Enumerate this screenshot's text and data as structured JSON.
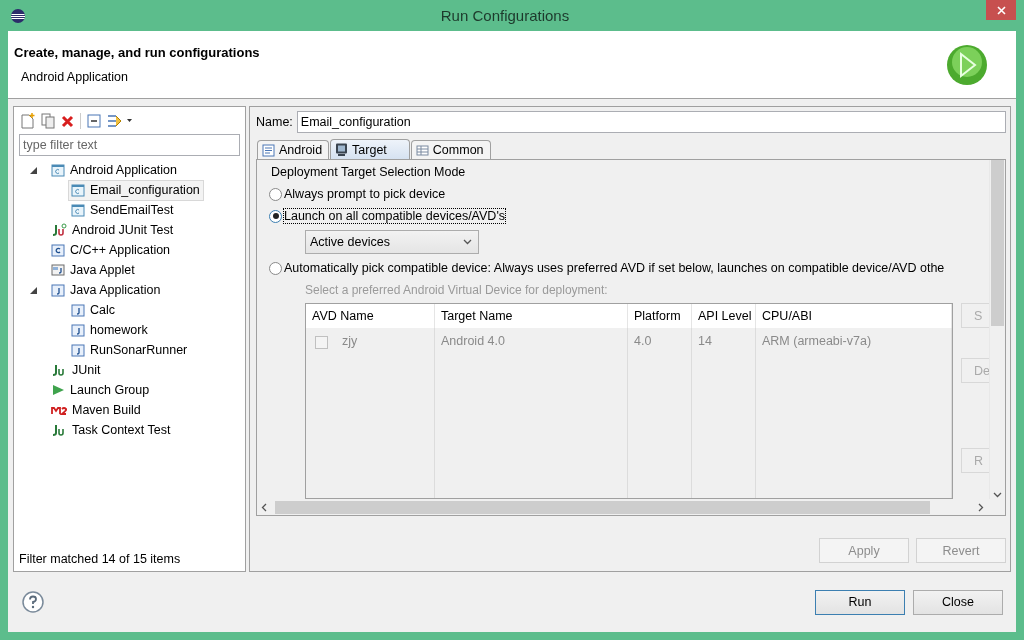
{
  "window": {
    "title": "Run Configurations"
  },
  "header": {
    "title": "Create, manage, and run configurations",
    "subtitle": "Android Application"
  },
  "sidebar": {
    "filter": {
      "placeholder": "type filter text"
    },
    "tree": [
      {
        "label": "Android Application",
        "kind": "android",
        "expanded": true,
        "selected": false,
        "children": [
          {
            "label": "Email_configuration",
            "kind": "android",
            "selected": true
          },
          {
            "label": "SendEmailTest",
            "kind": "android",
            "selected": false
          }
        ]
      },
      {
        "label": "Android JUnit Test",
        "kind": "junit-android",
        "selected": false
      },
      {
        "label": "C/C++ Application",
        "kind": "cpp",
        "selected": false
      },
      {
        "label": "Java Applet",
        "kind": "applet",
        "selected": false
      },
      {
        "label": "Java Application",
        "kind": "java",
        "expanded": true,
        "selected": false,
        "children": [
          {
            "label": "Calc",
            "kind": "java",
            "selected": false
          },
          {
            "label": "homework",
            "kind": "java",
            "selected": false
          },
          {
            "label": "RunSonarRunner",
            "kind": "java",
            "selected": false
          }
        ]
      },
      {
        "label": "JUnit",
        "kind": "junit",
        "selected": false
      },
      {
        "label": "Launch Group",
        "kind": "launch",
        "selected": false
      },
      {
        "label": "Maven Build",
        "kind": "maven",
        "selected": false
      },
      {
        "label": "Task Context Test",
        "kind": "task",
        "selected": false
      }
    ],
    "status": "Filter matched 14 of 15 items"
  },
  "editor": {
    "name_label": "Name:",
    "name_value": "Email_configuration",
    "tabs": [
      {
        "label": "Android",
        "kind": "doc",
        "selected": false
      },
      {
        "label": "Target",
        "kind": "monitor",
        "selected": true
      },
      {
        "label": "Common",
        "kind": "table",
        "selected": false
      }
    ],
    "group_title": "Deployment Target Selection Mode",
    "options": [
      {
        "label": "Always prompt to pick device",
        "selected": false
      },
      {
        "label": "Launch on all compatible devices/AVD's",
        "selected": true
      },
      {
        "label": "Automatically pick compatible device: Always uses preferred AVD if set below, launches on compatible device/AVD othe",
        "selected": false
      }
    ],
    "device_dropdown": {
      "value": "Active devices"
    },
    "avd_hint": "Select a preferred Android Virtual Device for deployment:",
    "table": {
      "columns": [
        "AVD Name",
        "Target Name",
        "Platform",
        "API Level",
        "CPU/ABI"
      ],
      "rows": [
        {
          "checked": false,
          "cells": [
            "zjy",
            "Android 4.0",
            "4.0",
            "14",
            "ARM (armeabi-v7a)"
          ]
        }
      ]
    },
    "side_buttons": [
      "S",
      "De",
      "R"
    ],
    "buttons": [
      {
        "label": "Apply",
        "disabled": true
      },
      {
        "label": "Revert",
        "disabled": true
      }
    ]
  },
  "footer": {
    "buttons": [
      {
        "label": "Run",
        "default": true
      },
      {
        "label": "Close",
        "default": false
      }
    ]
  }
}
